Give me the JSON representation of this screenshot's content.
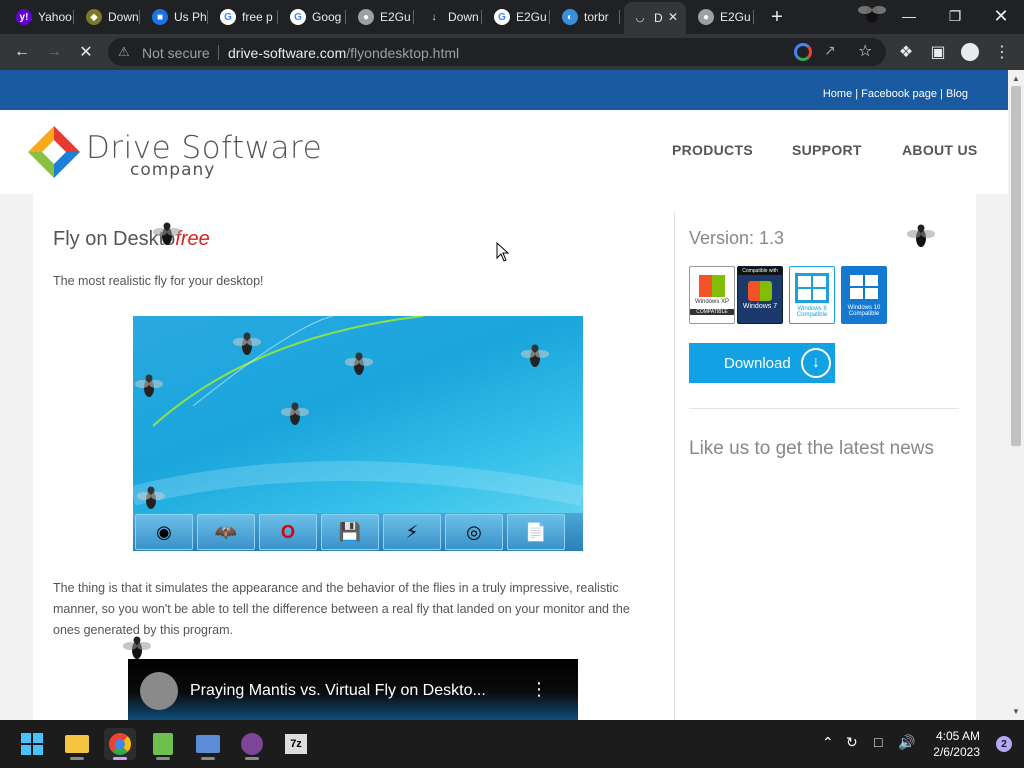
{
  "browser": {
    "tabs": [
      {
        "title": "Yahoo",
        "icon": "yahoo-icon",
        "color": "#6001d2"
      },
      {
        "title": "Down",
        "icon": "shield-icon",
        "color": "#7a7a2a"
      },
      {
        "title": "Us Ph",
        "icon": "chat-icon",
        "color": "#1a73e8"
      },
      {
        "title": "free p",
        "icon": "google-icon",
        "color": "#ffffff"
      },
      {
        "title": "Goog",
        "icon": "google-icon",
        "color": "#ffffff"
      },
      {
        "title": "E2Gu",
        "icon": "globe-icon",
        "color": "#9aa0a6"
      },
      {
        "title": "Down",
        "icon": "download-icon",
        "color": "#e8eaed"
      },
      {
        "title": "E2Gu",
        "icon": "google-icon",
        "color": "#ffffff"
      },
      {
        "title": "torbr",
        "icon": "tor-icon",
        "color": "#3a8fd9"
      },
      {
        "title": "D",
        "icon": "loading-icon",
        "color": "#e8eaed",
        "active": true
      },
      {
        "title": "E2Gu",
        "icon": "globe-icon",
        "color": "#9aa0a6"
      }
    ],
    "new_tab_label": "+",
    "address": {
      "security_label": "Not secure",
      "domain": "drive-software.com",
      "path": "/flyondesktop.html"
    }
  },
  "site": {
    "top_links": "Home | Facebook page | Blog",
    "logo_name": "Drive Software",
    "logo_sub": "company",
    "nav": [
      "PRODUCTS",
      "SUPPORT",
      "ABOUT US"
    ],
    "title_main": "Fly on Deskto",
    "title_free": "free",
    "tagline": "The most realistic fly for your desktop!",
    "paragraph": "The thing is that it simulates the appearance and the behavior of the flies in a truly impressive, realistic manner, so you won't be able to tell the difference between a real fly that landed on your monitor and the ones generated by this program.",
    "video_title": "Praying Mantis vs. Virtual Fly on Deskto...",
    "version": "Version: 1.3",
    "badges": [
      {
        "label": "Windows XP",
        "sub": "COMPATIBLE",
        "bg": "#ffffff",
        "fg": "#333333"
      },
      {
        "label": "Windows 7",
        "sub": "Compatible with",
        "bg": "#1b3a6b",
        "fg": "#ffffff"
      },
      {
        "label": "Windows 8",
        "sub": "Compatible",
        "bg": "#ffffff",
        "fg": "#1ea0e0"
      },
      {
        "label": "Windows 10",
        "sub": "Compatible",
        "bg": "#1479d1",
        "fg": "#ffffff"
      }
    ],
    "download_label": "Download",
    "like_us": "Like us to get the latest news"
  },
  "os_taskbar": {
    "time": "4:05 AM",
    "date": "2/6/2023",
    "notification_count": "2"
  },
  "colors": {
    "topbar": "#195aa0",
    "download": "#12a2e3",
    "free_red": "#d32222"
  }
}
